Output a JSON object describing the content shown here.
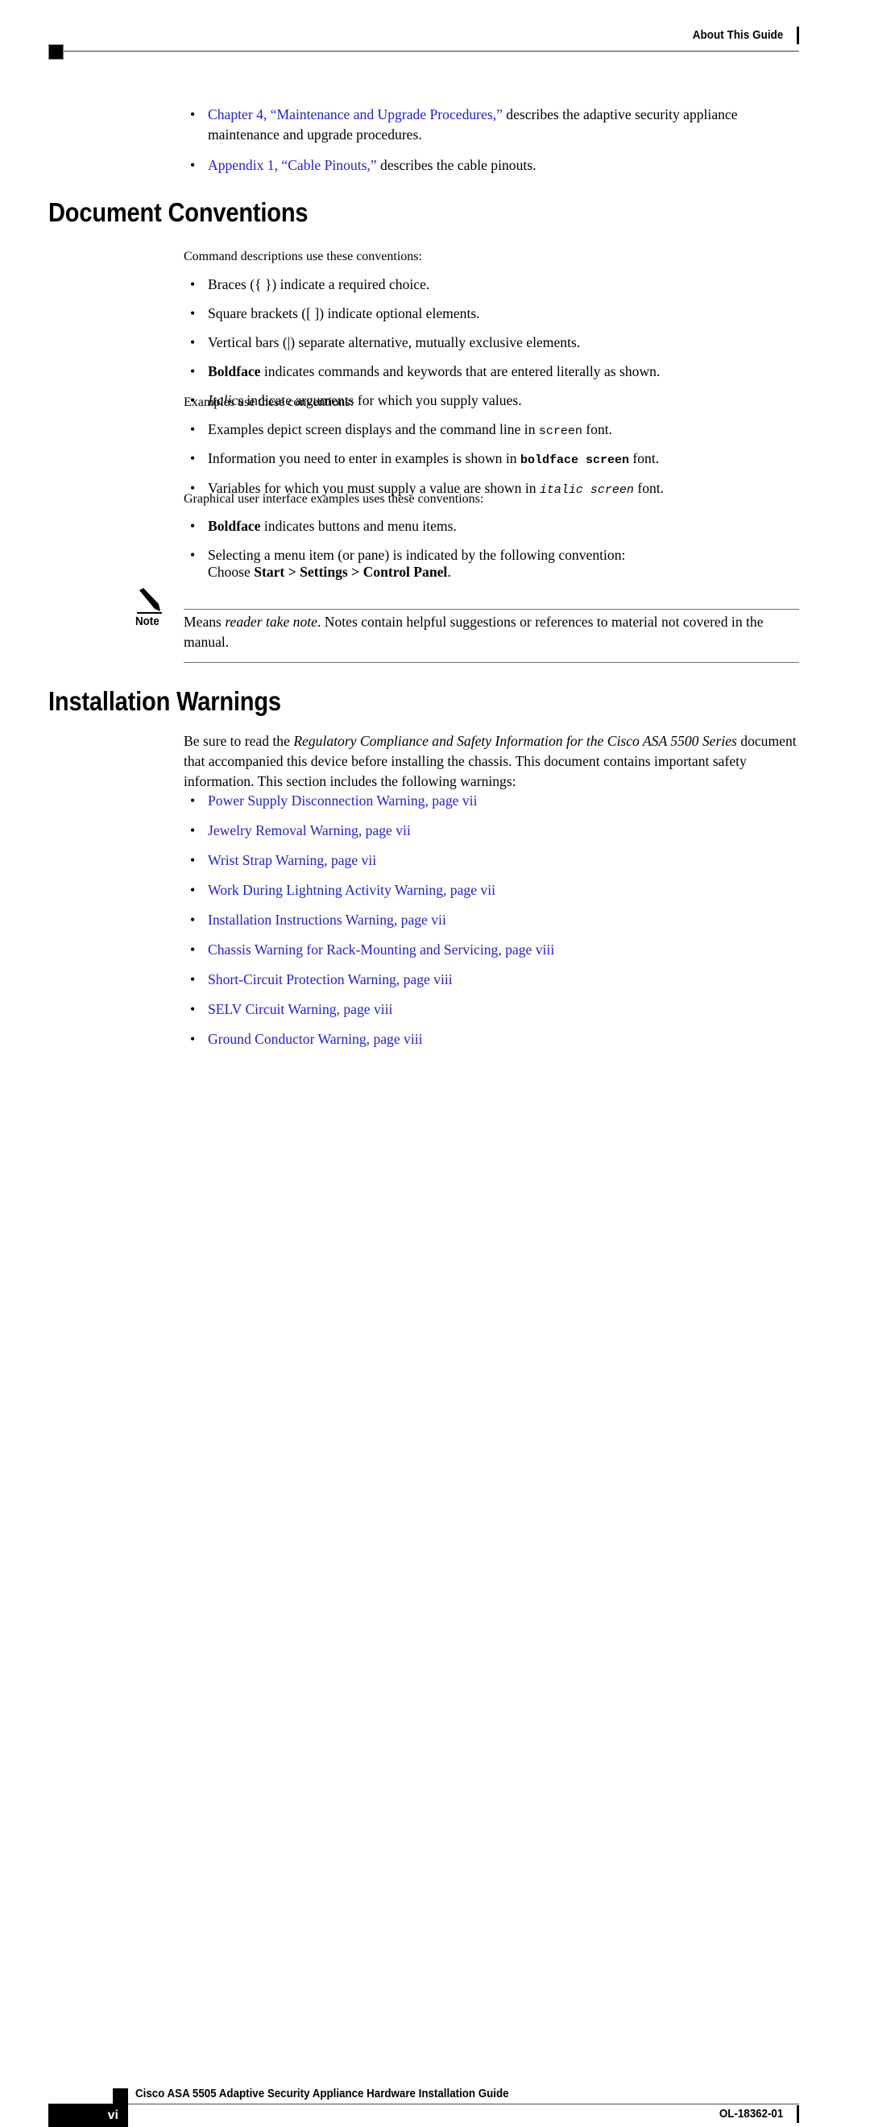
{
  "header": {
    "running_head": "About This Guide"
  },
  "intro_list": [
    {
      "link": "Chapter 4, “Maintenance and Upgrade Procedures,”",
      "rest": " describes the adaptive security appliance maintenance and upgrade procedures."
    },
    {
      "link": "Appendix 1, “Cable Pinouts,”",
      "rest": " describes the cable pinouts."
    }
  ],
  "document_conventions": {
    "heading": "Document Conventions",
    "intro": "Command descriptions use these conventions:",
    "command_bullets": [
      {
        "lead": "",
        "lead_style": "none",
        "text": "Braces ({ }) indicate a required choice."
      },
      {
        "lead": "",
        "lead_style": "none",
        "text": "Square brackets ([ ]) indicate optional elements."
      },
      {
        "lead": "",
        "lead_style": "none",
        "text": "Vertical bars (|) separate alternative, mutually exclusive elements."
      },
      {
        "lead": "Boldface",
        "lead_style": "bold",
        "text": " indicates commands and keywords that are entered literally as shown."
      },
      {
        "lead": "Italics",
        "lead_style": "italic",
        "text": " indicate arguments for which you supply values."
      }
    ],
    "examples_intro": "Examples use these conventions:",
    "examples_bullets": [
      {
        "before": "Examples depict screen displays and the command line in ",
        "code": "screen",
        "code_style": "regular",
        "after": " font."
      },
      {
        "before": "Information you need to enter in examples is shown in ",
        "code": "boldface screen",
        "code_style": "bold",
        "after": " font."
      },
      {
        "before": "Variables for which you must supply a value are shown in ",
        "code": "italic screen",
        "code_style": "italic",
        "after": " font."
      }
    ],
    "gui_intro": "Graphical user interface examples uses these conventions:",
    "gui_bullets": [
      {
        "lead": "Boldface",
        "lead_style": "bold",
        "text": " indicates buttons and menu items."
      },
      {
        "lead": "",
        "lead_style": "none",
        "text": "Selecting a menu item (or pane) is indicated by the following convention:"
      }
    ],
    "menu_example": {
      "prefix": "Choose ",
      "path": "Start > Settings > Control Panel",
      "suffix": "."
    }
  },
  "note": {
    "icon": "pencil-icon",
    "label": "Note",
    "before_italic": "Means ",
    "italic": "reader take note",
    "after_italic": ". Notes contain helpful suggestions or references to material not covered in the manual."
  },
  "installation_warnings": {
    "heading": "Installation Warnings",
    "paragraph_before_italic": "Be sure to read the ",
    "paragraph_italic": "Regulatory Compliance and Safety Information for the Cisco ASA 5500 Series",
    "paragraph_after_italic": " document that accompanied this device before installing the chassis. This document contains important safety information. This section includes the following warnings:",
    "warning_links": [
      "Power Supply Disconnection Warning, page vii",
      "Jewelry Removal Warning, page vii",
      "Wrist Strap Warning, page vii",
      "Work During Lightning Activity Warning, page vii",
      "Installation Instructions Warning, page vii",
      "Chassis Warning for Rack-Mounting and Servicing, page viii",
      "Short-Circuit Protection Warning, page viii",
      "SELV Circuit Warning, page viii",
      "Ground Conductor Warning, page viii"
    ]
  },
  "footer": {
    "guide_title": "Cisco ASA 5505 Adaptive Security Appliance Hardware Installation Guide",
    "page_number": "vi",
    "document_id": "OL-18362-01"
  },
  "colors": {
    "link_blue": "#2222cc",
    "text_black": "#000000",
    "rule_gray": "#6f6f6f"
  }
}
